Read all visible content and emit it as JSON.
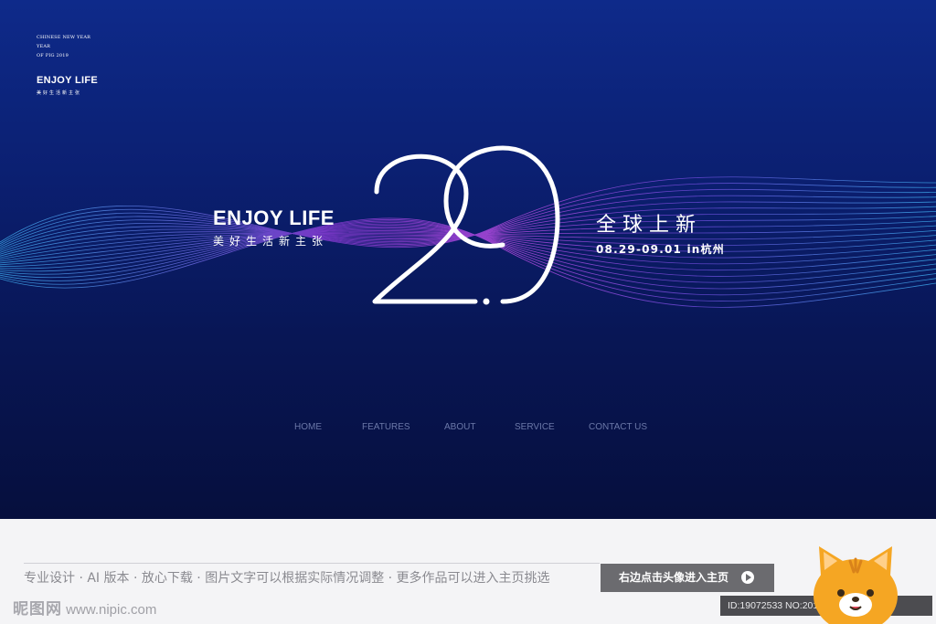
{
  "corner": {
    "line1": "CHINESE NEW YEAR",
    "line2": "YEAR",
    "line3": "OF PIG 2019",
    "brand": "ENJOY LIFE",
    "subtitle": "美好生活新主张"
  },
  "hero": {
    "title": "ENJOY LIFE",
    "subtitle": "美好生活新主张",
    "big_number": "29",
    "headline": "全球上新",
    "dates": "08.29-09.01 in杭州"
  },
  "nav": {
    "items": [
      {
        "label": "HOME"
      },
      {
        "label": "FEATURES"
      },
      {
        "label": "ABOUT"
      },
      {
        "label": "SERVICE"
      },
      {
        "label": "CONTACT US"
      }
    ]
  },
  "footer": {
    "tagline": "专业设计 · AI 版本 · 放心下载 · 图片文字可以根据实际情况调整 · 更多作品可以进入主页挑选",
    "cta_label": "右边点击头像进入主页",
    "watermark_logo": "昵图网",
    "watermark_url": "www.nipic.com",
    "id_text": "ID:19072533 NO:20190807135014039"
  },
  "icons": {
    "cta": "play-circle-icon",
    "avatar": "cat-avatar-icon"
  },
  "colors": {
    "hero_top": "#0e2a8a",
    "hero_bottom": "#060f3d",
    "wave_cyan": "#3aa8e8",
    "wave_purple": "#8a3bd6",
    "nav_text": "#6b78a8",
    "cta_bg": "#6b6b6f"
  }
}
